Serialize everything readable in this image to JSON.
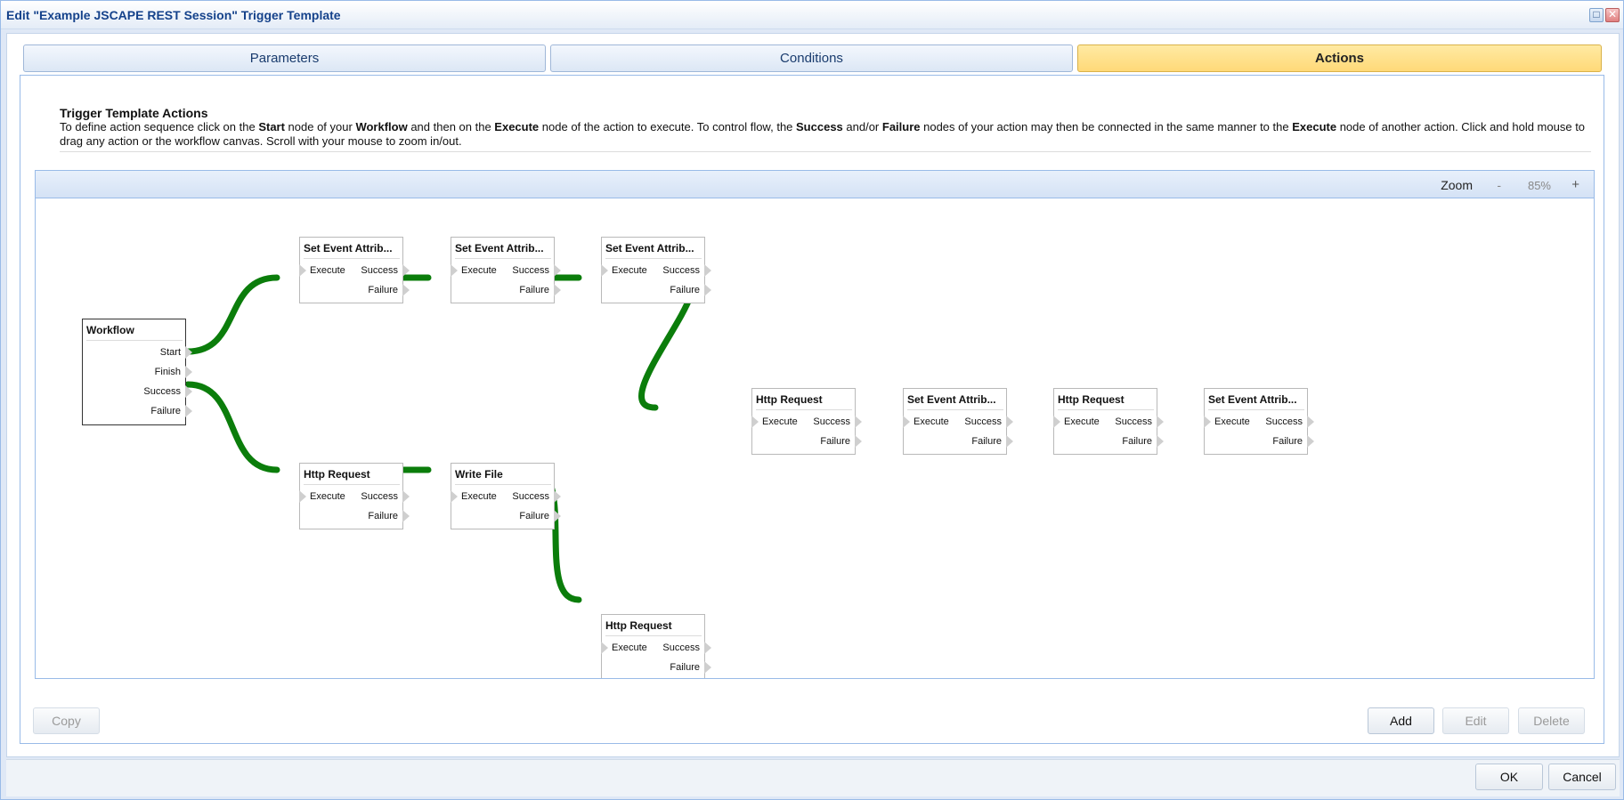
{
  "window": {
    "title": "Edit \"Example JSCAPE REST Session\" Trigger Template",
    "maximize_glyph": "□",
    "close_glyph": "✕"
  },
  "tabs": [
    {
      "label": "Parameters",
      "active": false
    },
    {
      "label": "Conditions",
      "active": false
    },
    {
      "label": "Actions",
      "active": true
    }
  ],
  "description": {
    "title": "Trigger Template Actions",
    "segments": [
      {
        "text": "To define action sequence click on the ",
        "bold": false
      },
      {
        "text": "Start",
        "bold": true
      },
      {
        "text": " node of your ",
        "bold": false
      },
      {
        "text": "Workflow",
        "bold": true
      },
      {
        "text": " and then on the ",
        "bold": false
      },
      {
        "text": "Execute",
        "bold": true
      },
      {
        "text": " node of the action to execute. To control flow, the ",
        "bold": false
      },
      {
        "text": "Success",
        "bold": true
      },
      {
        "text": " and/or ",
        "bold": false
      },
      {
        "text": "Failure",
        "bold": true
      },
      {
        "text": " nodes of your action may then be connected in the same manner to the ",
        "bold": false
      },
      {
        "text": "Execute",
        "bold": true
      },
      {
        "text": " node of another action. Click and hold mouse to drag any action or the workflow canvas. Scroll with your mouse to zoom in/out.",
        "bold": false
      }
    ]
  },
  "zoom": {
    "label": "Zoom",
    "minus": "-",
    "value": "85%",
    "plus": "+"
  },
  "ports": {
    "execute": "Execute",
    "success": "Success",
    "failure": "Failure",
    "start": "Start",
    "finish": "Finish"
  },
  "workflow_node": {
    "title": "Workflow"
  },
  "action_nodes": [
    {
      "title": "Set Event Attrib..."
    },
    {
      "title": "Set Event Attrib..."
    },
    {
      "title": "Set Event Attrib..."
    },
    {
      "title": "Http Request"
    },
    {
      "title": "Set Event Attrib..."
    },
    {
      "title": "Http Request"
    },
    {
      "title": "Set Event Attrib..."
    },
    {
      "title": "Http Request"
    },
    {
      "title": "Write File"
    },
    {
      "title": "Http Request"
    }
  ],
  "buttons": {
    "copy": "Copy",
    "add": "Add",
    "edit": "Edit",
    "delete": "Delete",
    "ok": "OK",
    "cancel": "Cancel"
  },
  "colors": {
    "connector": "#0b7d0b",
    "active_tab": "#ffd978"
  }
}
